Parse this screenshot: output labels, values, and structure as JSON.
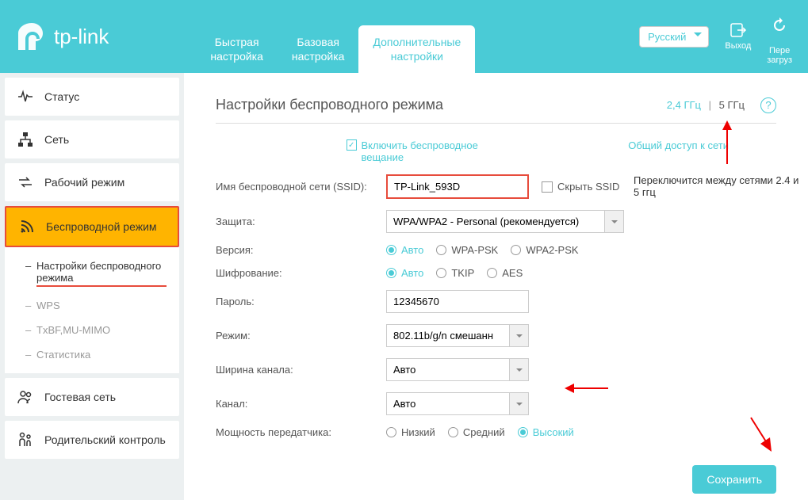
{
  "header": {
    "brand": "tp-link",
    "tabs": {
      "quick": "Быстрая\nнастройка",
      "basic": "Базовая\nнастройка",
      "advanced": "Дополнительные\nнастройки"
    },
    "language": "Русский",
    "logout": "Выход",
    "reboot": "Пере\nзагруз"
  },
  "sidebar": {
    "status": "Статус",
    "network": "Сеть",
    "opmode": "Рабочий режим",
    "wireless": "Беспроводной режим",
    "sub": {
      "settings": "Настройки беспроводного режима",
      "wps": "WPS",
      "txbf": "TxBF,MU-MIMO",
      "stats": "Статистика"
    },
    "guest": "Гостевая сеть",
    "parental": "Родительский контроль"
  },
  "page": {
    "title": "Настройки беспроводного режима",
    "band24": "2,4 ГГц",
    "band5": "5 ГГц",
    "enable_radio": "Включить беспроводное вещание",
    "share": "Общий доступ к сети",
    "ssid_label": "Имя беспроводной сети (SSID):",
    "ssid_value": "TP-Link_593D",
    "hide_ssid": "Скрыть SSID",
    "security_label": "Защита:",
    "security_value": "WPA/WPA2 - Personal (рекомендуется)",
    "version_label": "Версия:",
    "version_opts": {
      "auto": "Авто",
      "wpa": "WPA-PSK",
      "wpa2": "WPA2-PSK"
    },
    "encryption_label": "Шифрование:",
    "encryption_opts": {
      "auto": "Авто",
      "tkip": "TKIP",
      "aes": "AES"
    },
    "password_label": "Пароль:",
    "password_value": "12345670",
    "mode_label": "Режим:",
    "mode_value": "802.11b/g/n смешанн",
    "width_label": "Ширина канала:",
    "width_value": "Авто",
    "channel_label": "Канал:",
    "channel_value": "Авто",
    "txpower_label": "Мощность передатчика:",
    "txpower_opts": {
      "low": "Низкий",
      "mid": "Средний",
      "high": "Высокий"
    },
    "save": "Сохранить"
  },
  "annotation": "Переключится между сетями 2.4 и 5 ггц"
}
